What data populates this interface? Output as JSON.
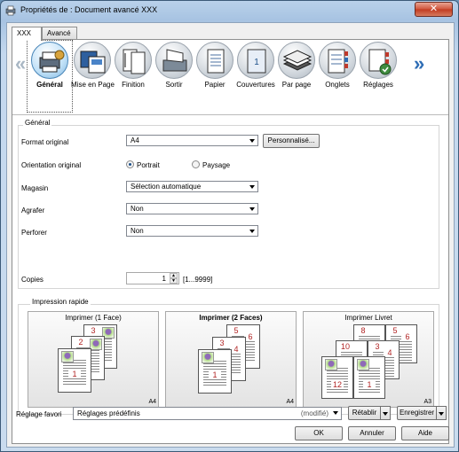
{
  "window": {
    "title": "Propriétés de : Document avancé XXX",
    "close_label": "✕"
  },
  "tabs": [
    {
      "label": "XXX"
    },
    {
      "label": "Avancé"
    }
  ],
  "categories": [
    {
      "label": "Général",
      "icon": "general-icon",
      "selected": true
    },
    {
      "label": "Mise en Page",
      "icon": "layout-icon"
    },
    {
      "label": "Finition",
      "icon": "finishing-icon"
    },
    {
      "label": "Sortir",
      "icon": "output-icon"
    },
    {
      "label": "Papier",
      "icon": "paper-icon"
    },
    {
      "label": "Couvertures",
      "icon": "covers-icon"
    },
    {
      "label": "Par page",
      "icon": "per-page-icon"
    },
    {
      "label": "Onglets",
      "icon": "tabs-icon"
    },
    {
      "label": "Réglages",
      "icon": "settings-icon"
    }
  ],
  "nav": {
    "prev": "«",
    "next": "»"
  },
  "general": {
    "group_title": "Général",
    "format_label": "Format original",
    "format_value": "A4",
    "custom_button": "Personnalisé...",
    "orientation_label": "Orientation original",
    "portrait_label": "Portrait",
    "landscape_label": "Paysage",
    "orientation_value": "Portrait",
    "tray_label": "Magasin",
    "tray_value": "Sélection automatique",
    "staple_label": "Agrafer",
    "staple_value": "Non",
    "punch_label": "Perforer",
    "punch_value": "Non",
    "copies_label": "Copies",
    "copies_value": "1",
    "copies_range": "[1...9999]"
  },
  "quick_print": {
    "title": "Impression rapide",
    "options": [
      {
        "label": "Imprimer (1 Face)",
        "size": "A4",
        "bold": false,
        "pages": [
          "1",
          "2",
          "3"
        ]
      },
      {
        "label": "Imprimer (2 Faces)",
        "size": "A4",
        "bold": true,
        "pages": [
          "1",
          "3",
          "4",
          "5",
          "6"
        ]
      },
      {
        "label": "Imprimer Livret",
        "size": "A3",
        "bold": false,
        "pages": [
          "12",
          "1",
          "10",
          "3",
          "4",
          "8",
          "5",
          "6"
        ]
      }
    ]
  },
  "favorites": {
    "label": "Réglage favori",
    "value": "Réglages prédéfinis",
    "modified": "(modifié)",
    "restore_button": "Rétablir",
    "save_button": "Enregistrer"
  },
  "buttons": {
    "ok": "OK",
    "cancel": "Annuler",
    "help": "Aide"
  }
}
